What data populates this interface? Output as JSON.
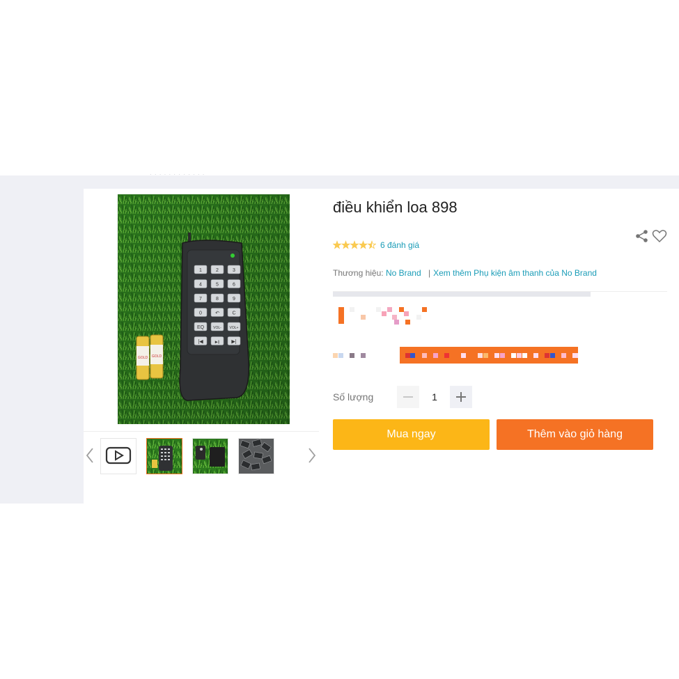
{
  "product": {
    "title": "điều khiển loa 898",
    "rating": {
      "stars": 4.5,
      "count_label": "6 đánh giá"
    },
    "brand": {
      "label": "Thương hiệu:",
      "name": "No Brand",
      "more_link": "Xem thêm Phụ kiện âm thanh của No Brand"
    }
  },
  "remote": {
    "keys": [
      "1",
      "2",
      "3",
      "4",
      "5",
      "6",
      "7",
      "8",
      "9",
      "0",
      "↶",
      "C",
      "EQ",
      "VOL-",
      "VOL+",
      "|◀",
      "▶||",
      "▶|"
    ]
  },
  "batteries": {
    "label": "GOLD"
  },
  "quantity": {
    "label": "Số lượng",
    "value": "1"
  },
  "actions": {
    "buy_now": "Mua ngay",
    "add_to_cart": "Thêm vào giỏ hàng"
  },
  "gallery": {
    "thumbnails": [
      "video",
      "remote-front",
      "remote-receiver",
      "remote-pile"
    ],
    "active_index": 1
  },
  "colors": {
    "accent_orange": "#f57224",
    "buy_yellow": "#fcb617",
    "link_blue": "#1a9cb7",
    "star_yellow": "#faca51",
    "band_gray": "#eff0f5"
  }
}
